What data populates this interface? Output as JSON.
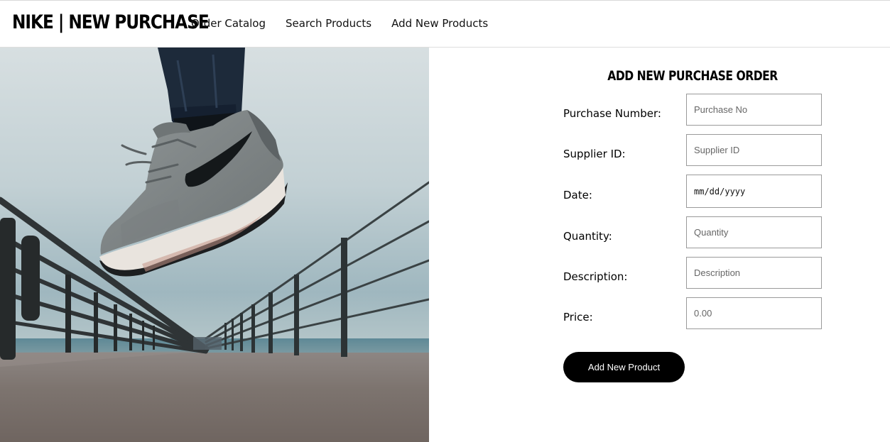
{
  "header": {
    "brand": "NIKE | NEW PURCHASE",
    "nav": [
      {
        "label": "Order Catalog"
      },
      {
        "label": "Search Products"
      },
      {
        "label": "Add New Products"
      }
    ]
  },
  "hero": {
    "image": "sneaker-jump-photo"
  },
  "form": {
    "title": "ADD NEW PURCHASE ORDER",
    "fields": [
      {
        "label": "Purchase Number:",
        "placeholder": "Purchase No",
        "value": ""
      },
      {
        "label": "Supplier ID:",
        "placeholder": "Supplier ID",
        "value": ""
      },
      {
        "label": "Date:",
        "placeholder": "mm/dd/yyyy",
        "value": ""
      },
      {
        "label": "Quantity:",
        "placeholder": "Quantity",
        "value": ""
      },
      {
        "label": "Description:",
        "placeholder": "Description",
        "value": ""
      },
      {
        "label": "Price:",
        "placeholder": "0.00",
        "value": ""
      }
    ],
    "submit_label": "Add New Product"
  },
  "colors": {
    "button_bg": "#000000",
    "button_text": "#ffffff",
    "input_border": "#9a9a9a"
  }
}
